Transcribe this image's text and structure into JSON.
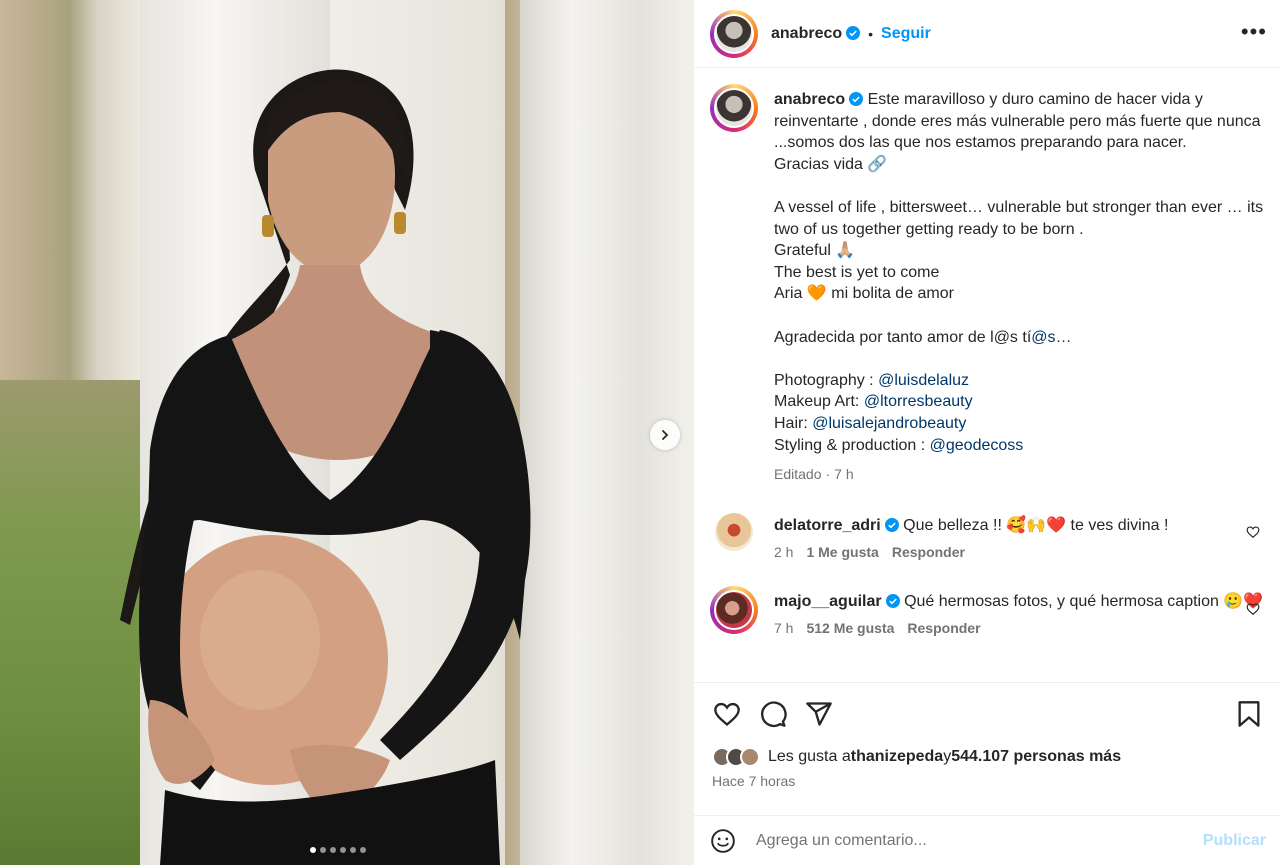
{
  "post": {
    "author": "anabreco",
    "follow_label": "Seguir",
    "separator": "•",
    "more_label": "•••",
    "carousel": {
      "total": 6,
      "current": 1
    }
  },
  "caption": {
    "user": "anabreco",
    "lines": [
      "Este maravilloso y duro camino de hacer vida y reinventarte , donde eres más vulnerable pero más fuerte que nunca ...somos dos las que nos estamos preparando para nacer.",
      "Gracias vida 🔗",
      "",
      "A vessel of life , bittersweet… vulnerable but stronger than ever … its two of us together getting ready to be born .",
      "Grateful 🙏🏼",
      "The best is yet to come",
      "Aria 🧡 mi bolita de amor",
      "",
      "Agradecida por tanto amor de l@s tí"
    ],
    "mention_truncated": "@s…",
    "credits": [
      {
        "label": "Photography : ",
        "handle": "@luisdelaluz"
      },
      {
        "label": "Makeup Art: ",
        "handle": "@ltorresbeauty"
      },
      {
        "label": "Hair: ",
        "handle": "@luisalejandrobeauty"
      },
      {
        "label": "Styling & production : ",
        "handle": "@geodecoss"
      }
    ],
    "edited": "Editado",
    "sep": "·",
    "time": "7 h"
  },
  "comments": [
    {
      "user": "delatorre_adri",
      "text": "Que belleza !! 🥰🙌❤️ te ves divina !",
      "time": "2 h",
      "likes": "1 Me gusta",
      "reply": "Responder"
    },
    {
      "user": "majo__aguilar",
      "text": "Qué hermosas fotos, y qué hermosa caption 🥲❤️",
      "time": "7 h",
      "likes": "512 Me gusta",
      "reply": "Responder"
    }
  ],
  "likes": {
    "prefix": "Les gusta a ",
    "user": "thanizepeda",
    "mid": " y ",
    "count": "544.107 personas más"
  },
  "posted_ago": "Hace 7 horas",
  "add_comment": {
    "placeholder": "Agrega un comentario...",
    "publish_label": "Publicar"
  },
  "colors": {
    "accent": "#0095f6",
    "link": "#00376b",
    "muted": "#737373",
    "publish_disabled": "#b2dffc"
  }
}
